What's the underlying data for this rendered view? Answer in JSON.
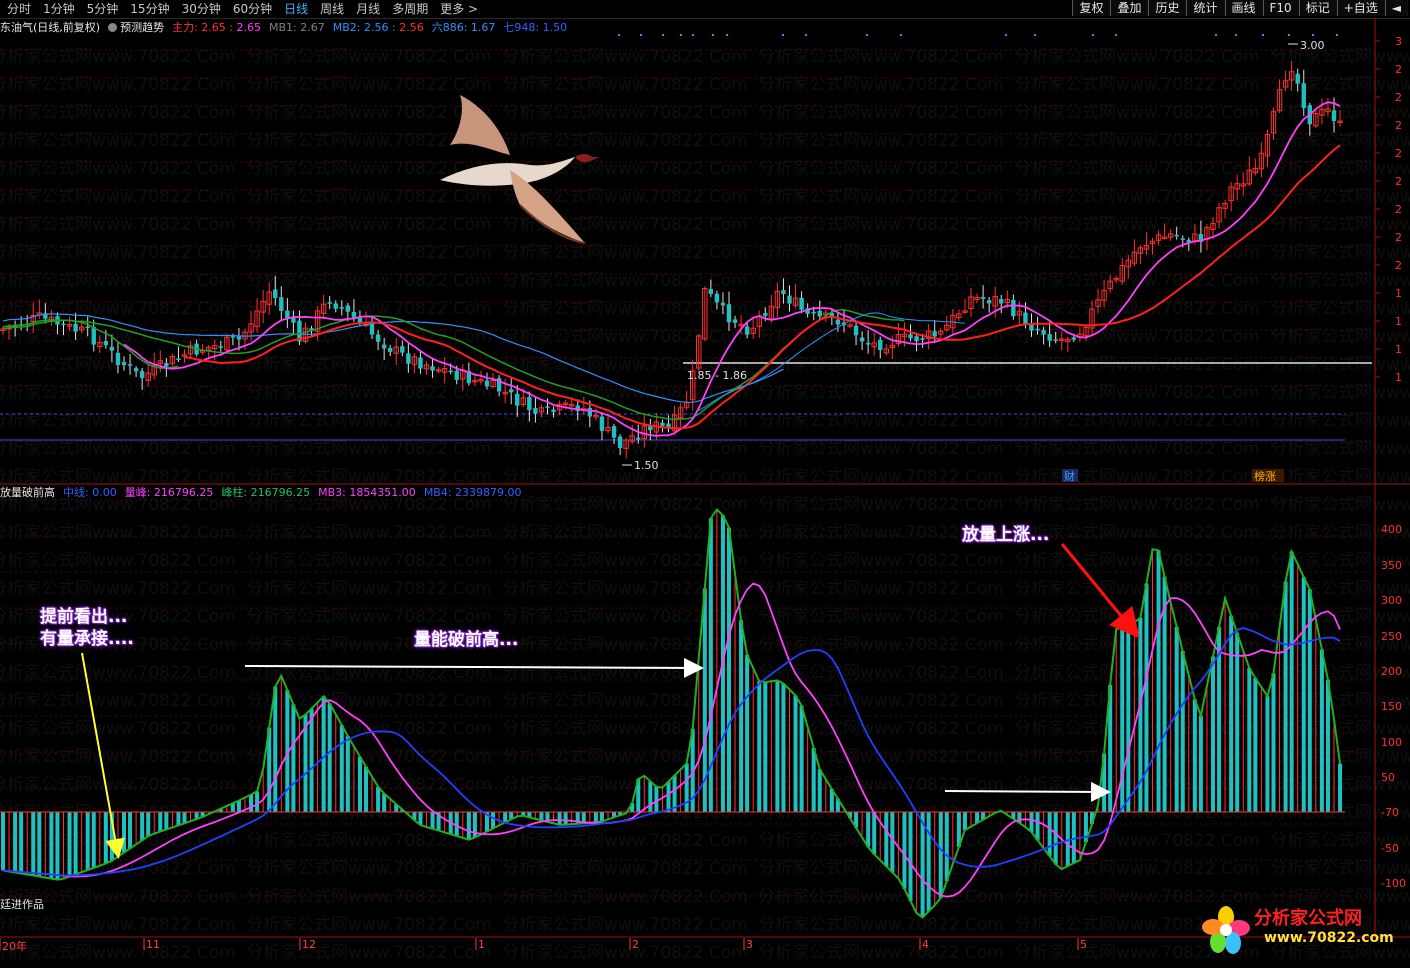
{
  "toolbar": {
    "periods": [
      "分时",
      "1分钟",
      "5分钟",
      "15分钟",
      "30分钟",
      "60分钟",
      "日线",
      "周线",
      "月线",
      "多周期",
      "更多 >"
    ],
    "active_period": "日线",
    "buttons": [
      "复权",
      "叠加",
      "历史",
      "统计",
      "画线",
      "F10",
      "标记",
      "+自选"
    ],
    "back_icon": "back-arrow-icon"
  },
  "main_legend": {
    "stock": "东油气(日线,前复权)",
    "forecast": "预测趋势",
    "zhuli_label": "主力:",
    "zhuli_v1": "2.65",
    "zhuli_v2": "2.65",
    "mb1": "MB1: 2.67",
    "mb2_label": "MB2:",
    "mb2_v1": "2.56",
    "mb2_v2": "2.56",
    "liu": "六886: 1.67",
    "qi": "七948: 1.50"
  },
  "main_annotations": {
    "high_label": "3.00",
    "low_label": "1.50",
    "mid_label": "1.85 - 1.86",
    "cai_badge": "财",
    "bang_badge": "榜涨"
  },
  "price_axis": [
    "3",
    "2",
    "2",
    "2",
    "2",
    "2",
    "2",
    "2",
    "2",
    "1",
    "1",
    "1",
    "1"
  ],
  "sub_legend": {
    "name": "放量破前高",
    "zhongxian": "中线: 0.00",
    "liangfeng": "量峰: 216796.25",
    "fengzhu": "峰柱: 216796.25",
    "mb3": "MB3: 1854351.00",
    "mb4": "MB4: 2339879.00"
  },
  "sub_axis": [
    "400",
    "350",
    "300",
    "250",
    "200",
    "150",
    "100",
    "50",
    "-70",
    "-50",
    "-100"
  ],
  "notes": {
    "note1_line1": "提前看出...",
    "note1_line2": "有量承接....",
    "note2": "量能破前高...",
    "note3": "放量上涨..."
  },
  "author_tag": "廷进作品",
  "dates": [
    "20年",
    "11",
    "12",
    "1",
    "2",
    "3",
    "4",
    "5"
  ],
  "logo": {
    "name": "分析家公式网",
    "url": "www.70822.com"
  },
  "watermark_text": "分析家公式网www.70822.Com",
  "colors": {
    "bg": "#000000",
    "up": "#ff3030",
    "down": "#20c0c0",
    "pink": "#ff40ff",
    "red_ma": "#ff2020",
    "green_ma": "#20a020",
    "blue_ma": "#2040ff",
    "sky_ma": "#3090ff"
  }
}
